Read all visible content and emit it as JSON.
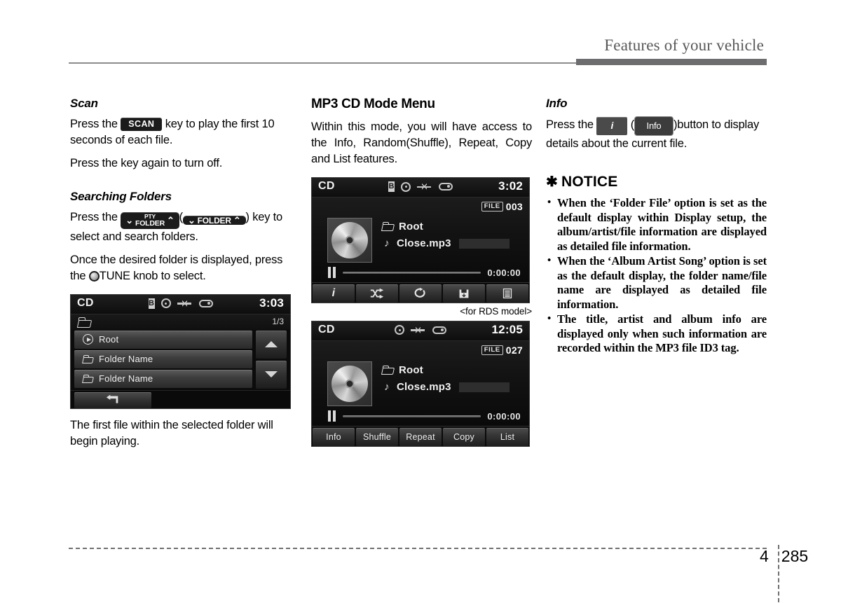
{
  "header": {
    "title": "Features of your vehicle"
  },
  "footer": {
    "chapter": "4",
    "page": "285"
  },
  "left_column": {
    "scan": {
      "heading": "Scan",
      "key_label": "SCAN",
      "text_before_key": "Press the",
      "text_after_key": "key to play the first 10 seconds of each file.",
      "paragraph2": "Press the key again to turn off."
    },
    "searching_folders": {
      "heading": "Searching Folders",
      "text_before_key": "Press  the",
      "key_primary_line1": "PTY",
      "key_primary_line2": "FOLDER",
      "key_secondary": "FOLDER",
      "chevron_down": "⌄",
      "chevron_up": "⌃",
      "paren_open": "(",
      "paren_close": ")",
      "text_after_key": "key to select and search folders.",
      "paragraph2_before_knob": "Once the desired folder is displayed, press the",
      "knob_label": "TUNE knob to select."
    },
    "list_screen": {
      "mode": "CD",
      "clock": "3:03",
      "page_indicator": "1/3",
      "rows": [
        {
          "icon": "play-circle-icon",
          "label": "Root"
        },
        {
          "icon": "folder-icon",
          "label": "Folder Name"
        },
        {
          "icon": "folder-icon",
          "label": "Folder Name"
        }
      ],
      "scroll_up_icon": "triangle-up-icon",
      "scroll_down_icon": "triangle-down-icon",
      "back_icon": "back-arrow-icon"
    },
    "closing_text": "The first file within the selected folder will begin playing."
  },
  "mid_column": {
    "heading": "MP3 CD Mode Menu",
    "paragraph": "Within this mode, you will have access to the Info, Random(Shuffle), Repeat, Copy and List features.",
    "screen_rds": {
      "mode": "CD",
      "clock": "3:02",
      "file_label": "FILE",
      "file_number": "003",
      "folder": "Root",
      "file": "Close.mp3",
      "time": "0:00:00",
      "buttons": [
        {
          "name": "info",
          "icon": "info-i-icon",
          "label": "i"
        },
        {
          "name": "shuffle",
          "icon": "shuffle-icon",
          "label": ""
        },
        {
          "name": "repeat",
          "icon": "repeat-icon",
          "label": ""
        },
        {
          "name": "copy",
          "icon": "save-copy-icon",
          "label": ""
        },
        {
          "name": "list",
          "icon": "list-icon",
          "label": ""
        }
      ],
      "status_icons": [
        "bluetooth-icon",
        "disc-icon",
        "usb-icon",
        "aux-icon"
      ]
    },
    "caption": "<for RDS model>",
    "screen_std": {
      "mode": "CD",
      "clock": "12:05",
      "file_label": "FILE",
      "file_number": "027",
      "folder": "Root",
      "file": "Close.mp3",
      "time": "0:00:00",
      "buttons": [
        {
          "name": "info",
          "label": "Info"
        },
        {
          "name": "shuffle",
          "label": "Shuffle"
        },
        {
          "name": "repeat",
          "label": "Repeat"
        },
        {
          "name": "copy",
          "label": "Copy"
        },
        {
          "name": "list",
          "label": "List"
        }
      ],
      "status_icons": [
        "disc-icon",
        "usb-icon",
        "aux-icon"
      ]
    }
  },
  "right_column": {
    "info": {
      "heading": "Info",
      "text_before_key": "Press the",
      "key_i": "i",
      "paren_open": "(",
      "key_info": "Info",
      "text_after_key": ")button to display details about the current file."
    },
    "notice": {
      "star": "✱",
      "heading": "NOTICE",
      "items": [
        "When the ‘Folder File’ option is set as the default display within Display setup, the album/artist/file information are displayed as detailed file information.",
        "When the ‘Album Artist Song’ option is set as the default display, the folder name/file name are displayed as detailed file information.",
        "The title, artist and album info are displayed only when such information are recorded within the MP3 file ID3 tag."
      ]
    }
  },
  "colors": {
    "header_gray": "#58585a",
    "rule_gray": "#6d6d6f",
    "screen_black": "#0b0b0b"
  }
}
